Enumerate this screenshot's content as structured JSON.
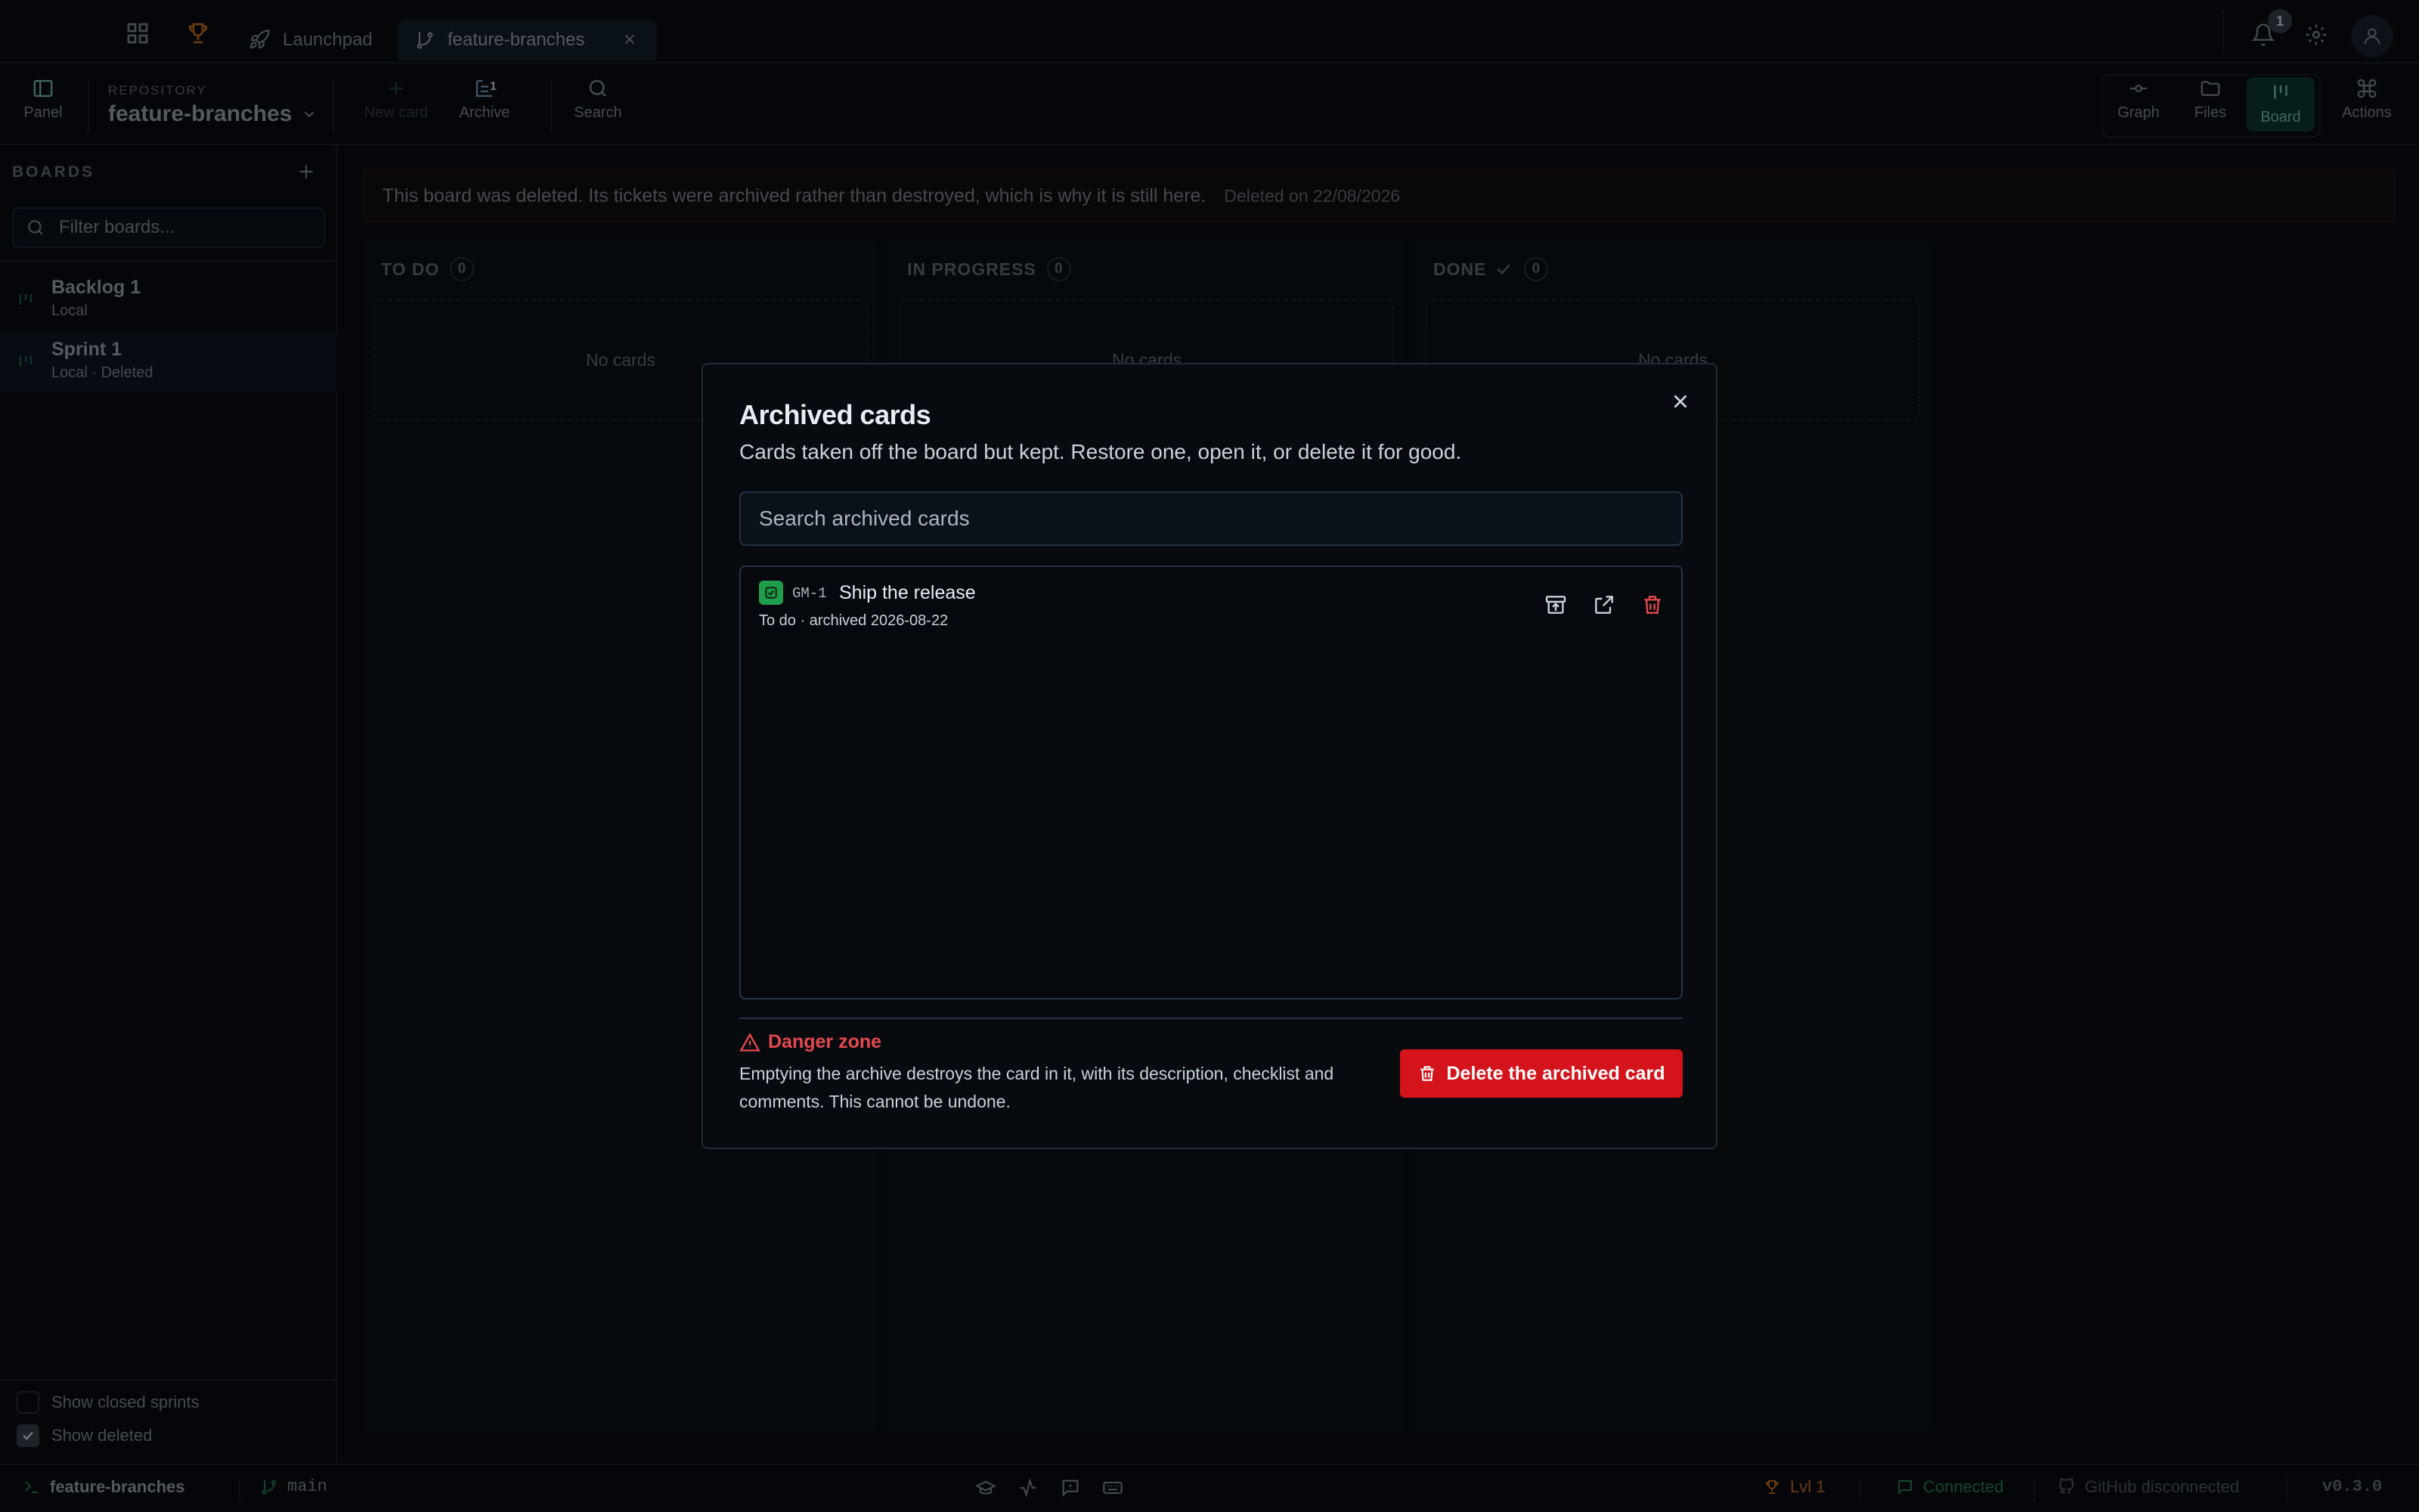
{
  "topbar": {
    "tabs": [
      {
        "label": "Launchpad",
        "icon": "rocket-icon"
      },
      {
        "label": "feature-branches",
        "icon": "git-branch-icon",
        "active": true
      }
    ],
    "notifications_count": "1"
  },
  "toolbar": {
    "panel_label": "Panel",
    "repo_caption": "REPOSITORY",
    "repo_name": "feature-branches",
    "new_card_label": "New card",
    "archive_label": "Archive",
    "archive_count": "1",
    "search_label": "Search",
    "views": [
      "Graph",
      "Files",
      "Board",
      "Actions"
    ],
    "active_view": "Board"
  },
  "sidebar": {
    "title": "BOARDS",
    "filter_placeholder": "Filter boards...",
    "boards": [
      {
        "name": "Backlog 1",
        "sub": "Local"
      },
      {
        "name": "Sprint 1",
        "sub": "Local · Deleted",
        "selected": true
      }
    ],
    "show_closed_label": "Show closed sprints",
    "show_closed_checked": false,
    "show_deleted_label": "Show deleted",
    "show_deleted_checked": true
  },
  "banner": {
    "text": "This board was deleted. Its tickets were archived rather than destroyed, which is why it is still here.",
    "date": "Deleted on 22/08/2026"
  },
  "columns": [
    {
      "title": "TO DO",
      "count": "0",
      "empty": "No cards"
    },
    {
      "title": "IN PROGRESS",
      "count": "0",
      "empty": "No cards"
    },
    {
      "title": "DONE",
      "count": "0",
      "empty": "No cards"
    }
  ],
  "modal": {
    "title": "Archived cards",
    "subtitle": "Cards taken off the board but kept. Restore one, open it, or delete it for good.",
    "search_placeholder": "Search archived cards",
    "items": [
      {
        "id": "GM-1",
        "title": "Ship the release",
        "meta": "To do · archived 2026-08-22"
      }
    ],
    "danger_title": "Danger zone",
    "danger_text": "Emptying the archive destroys the card in it, with its description, checklist and comments. This cannot be undone.",
    "delete_label": "Delete the archived card"
  },
  "statusbar": {
    "project": "feature-branches",
    "branch": "main",
    "level": "Lvl 1",
    "connection": "Connected",
    "github": "GitHub disconnected",
    "version": "v0.3.0"
  },
  "colors": {
    "accent": "#0f3a37",
    "danger": "#d4131a",
    "success": "#1f9d4a",
    "level": "#d4751f",
    "background": "#0b0f15"
  }
}
